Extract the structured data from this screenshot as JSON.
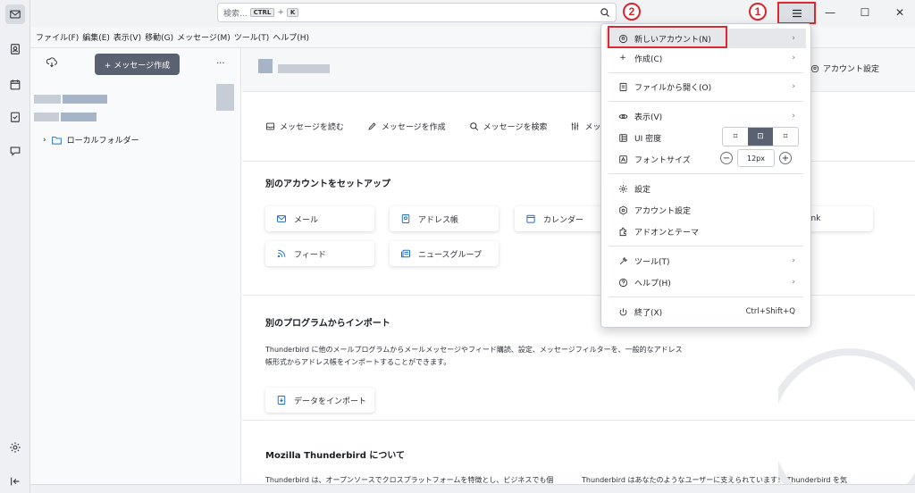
{
  "search": {
    "placeholder": "検索...",
    "key1": "CTRL",
    "plus": "+",
    "key2": "K"
  },
  "markers": {
    "one": "1",
    "two": "2"
  },
  "window": {
    "minimize": "—",
    "maximize": "☐",
    "close": "✕"
  },
  "menubar": [
    "ファイル(F)",
    "編集(E)",
    "表示(V)",
    "移動(G)",
    "メッセージ(M)",
    "ツール(T)",
    "ヘルプ(H)"
  ],
  "folderpane": {
    "compose_label": "+ メッセージ作成",
    "more": "···",
    "local_folders": "ローカルフォルダー"
  },
  "main": {
    "account_settings": "アカウント設定",
    "actions": [
      "メッセージを読む",
      "メッセージを作成",
      "メッセージを検索",
      "メッセー"
    ],
    "setup_title": "別のアカウントをセットアップ",
    "setup_cards": [
      "メール",
      "アドレス帳",
      "カレンダー",
      "フィード",
      "ニュースグループ"
    ],
    "chat_card_partial": "ink",
    "import_title": "別のプログラムからインポート",
    "import_text_1": "Thunderbird に他のメールプログラムからメールメッセージやフィード購読、設定、メッセージフィルターを、一般的なアドレス",
    "import_text_2": "帳形式からアドレス帳をインポートすることができます。",
    "import_button": "データをインポート",
    "about_title": "Mozilla Thunderbird について",
    "about_text_1": "Thunderbird は、オープンソースでクロスプラットフォームを特徴とし、ビジネスでも個",
    "about_text_2": "Thunderbird はあなたのようなユーザーに支えられています！ Thunderbird を気"
  },
  "appmenu": {
    "new_account": "新しいアカウント(N)",
    "create": "作成(C)",
    "open_file": "ファイルから開く(O)",
    "view": "表示(V)",
    "ui_density": "UI 密度",
    "font_size": "フォントサイズ",
    "font_size_value": "12px",
    "settings": "設定",
    "account_settings": "アカウント設定",
    "addons": "アドオンとテーマ",
    "tools": "ツール(T)",
    "help": "ヘルプ(H)",
    "quit": "終了(X)",
    "quit_shortcut": "Ctrl+Shift+Q"
  },
  "colors": {
    "accent": "#1f6dc7",
    "marker": "#e0272f"
  }
}
